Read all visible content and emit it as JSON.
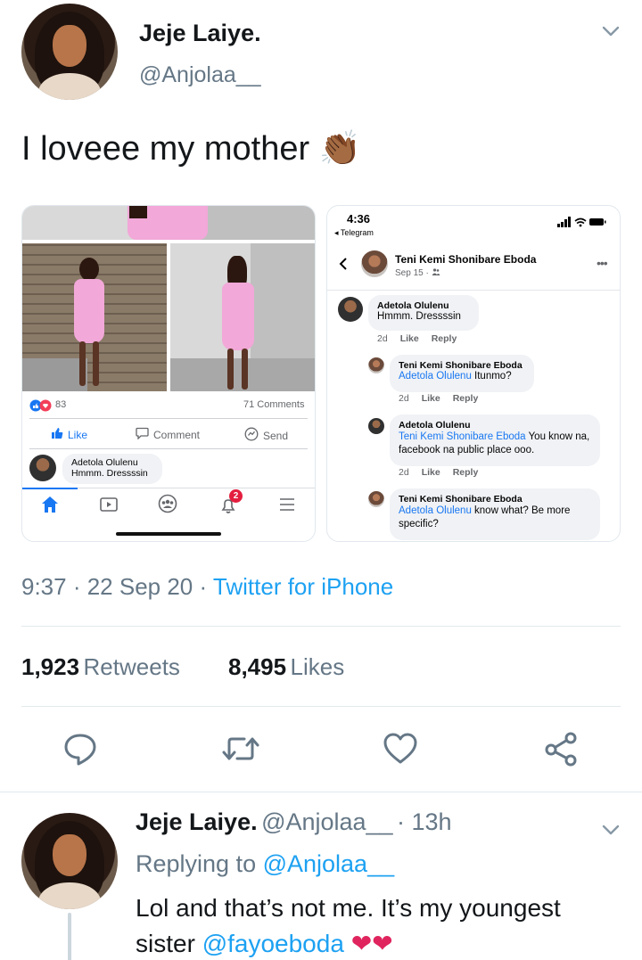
{
  "tweet": {
    "author": {
      "name": "Jeje Laiye.",
      "handle": "@Anjolaa__"
    },
    "text": "I loveee my mother",
    "emoji": "👏🏾",
    "time": "9:37 · 22 Sep 20 · ",
    "source": "Twitter for iPhone",
    "stats": {
      "retweets_count": "1,923",
      "retweets_label": "Retweets",
      "likes_count": "8,495",
      "likes_label": "Likes"
    }
  },
  "left_card": {
    "reaction_count": "83",
    "comments_count": "71 Comments",
    "actions": [
      "Like",
      "Comment",
      "Send"
    ],
    "comment": {
      "name": "Adetola Olulenu",
      "text": "Hmmm. Dressssin"
    },
    "notification_badge": "2"
  },
  "right_card": {
    "status_time": "4:36",
    "back_app": "◂ Telegram",
    "post_author": "Teni Kemi Shonibare Eboda",
    "post_date": "Sep 15 ·",
    "comments": [
      {
        "name": "Adetola Olulenu",
        "mention": "",
        "text": "Hmmm. Dressssin",
        "age": "2d",
        "like": "Like",
        "reply": "Reply"
      },
      {
        "name": "Teni Kemi Shonibare Eboda",
        "mention": "Adetola Olulenu",
        "text": " Itunmo?",
        "age": "2d",
        "like": "Like",
        "reply": "Reply"
      },
      {
        "name": "Adetola Olulenu",
        "mention": "Teni Kemi Shonibare Eboda",
        "text": " You know na, facebook na public place ooo.",
        "age": "2d",
        "like": "Like",
        "reply": "Reply"
      },
      {
        "name": "Teni Kemi Shonibare Eboda",
        "mention": "Adetola Olulenu",
        "text": " know what? Be more specific?",
        "age": "",
        "like": "",
        "reply": ""
      }
    ]
  },
  "reply": {
    "name": "Jeje Laiye.",
    "handle": "@Anjolaa__",
    "age": "· 13h",
    "replying_to_label": "Replying to ",
    "replying_to_handle": "@Anjolaa__",
    "text_line1": "Lol and that’s not me. It’s my youngest",
    "text_line2_prefix": "sister ",
    "text_mention": "@fayoeboda",
    "hearts": "❤❤"
  },
  "colors": {
    "accent": "#1da1f2",
    "secondary_text": "#657786",
    "facebook_blue": "#1877f2",
    "heart": "#e0245e"
  }
}
